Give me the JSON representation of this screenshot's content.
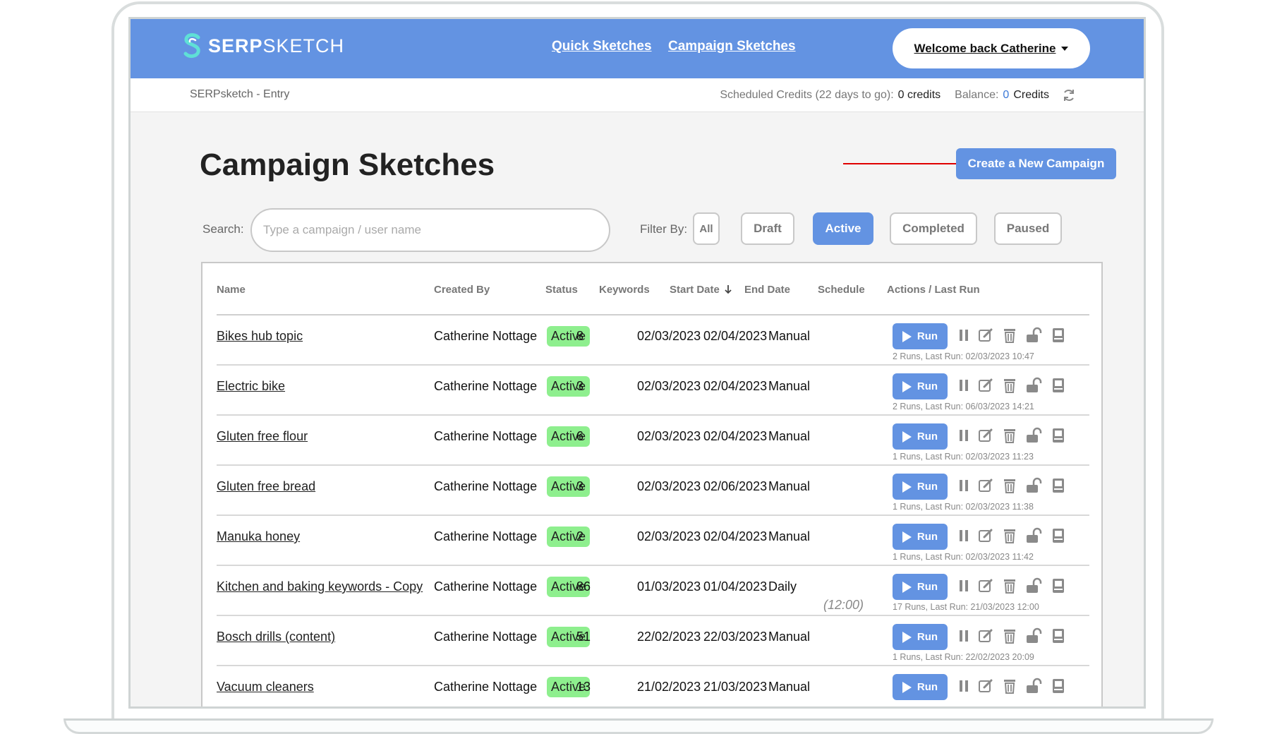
{
  "header": {
    "logo_bold": "SERP",
    "logo_light": "SKETCH",
    "nav": [
      "Quick Sketches",
      "Campaign Sketches"
    ],
    "welcome": "Welcome back Catherine"
  },
  "subbar": {
    "breadcrumb": "SERPsketch - Entry",
    "scheduled_label": "Scheduled Credits (22 days to go):",
    "scheduled_value": "0 credits",
    "balance_label": "Balance:",
    "balance_amount": "0",
    "balance_unit": "Credits"
  },
  "page": {
    "title": "Campaign Sketches",
    "create_button": "Create a New Campaign",
    "search_label": "Search:",
    "search_placeholder": "Type a campaign / user name",
    "filter_label": "Filter By:",
    "filters": [
      "All",
      "Draft",
      "Active",
      "Completed",
      "Paused"
    ],
    "active_filter": "Active"
  },
  "table": {
    "columns": [
      "Name",
      "Created By",
      "Status",
      "Keywords",
      "Start Date",
      "End Date",
      "Schedule",
      "Actions / Last Run"
    ],
    "run_label": "Run",
    "rows": [
      {
        "name": "Bikes hub topic",
        "created_by": "Catherine Nottage",
        "status": "Active",
        "keywords": "8",
        "start": "02/03/2023",
        "end": "02/04/2023",
        "schedule": "Manual",
        "schedule_sub": "",
        "last_run": "2 Runs, Last Run: 02/03/2023 10:47"
      },
      {
        "name": "Electric bike",
        "created_by": "Catherine Nottage",
        "status": "Active",
        "keywords": "3",
        "start": "02/03/2023",
        "end": "02/04/2023",
        "schedule": "Manual",
        "schedule_sub": "",
        "last_run": "2 Runs, Last Run: 06/03/2023 14:21"
      },
      {
        "name": "Gluten free flour",
        "created_by": "Catherine Nottage",
        "status": "Active",
        "keywords": "6",
        "start": "02/03/2023",
        "end": "02/04/2023",
        "schedule": "Manual",
        "schedule_sub": "",
        "last_run": "1 Runs, Last Run: 02/03/2023 11:23"
      },
      {
        "name": "Gluten free bread",
        "created_by": "Catherine Nottage",
        "status": "Active",
        "keywords": "3",
        "start": "02/03/2023",
        "end": "02/06/2023",
        "schedule": "Manual",
        "schedule_sub": "",
        "last_run": "1 Runs, Last Run: 02/03/2023 11:38"
      },
      {
        "name": "Manuka honey",
        "created_by": "Catherine Nottage",
        "status": "Active",
        "keywords": "2",
        "start": "02/03/2023",
        "end": "02/04/2023",
        "schedule": "Manual",
        "schedule_sub": "",
        "last_run": "1 Runs, Last Run: 02/03/2023 11:42"
      },
      {
        "name": "Kitchen and baking keywords - Copy",
        "created_by": "Catherine Nottage",
        "status": "Active",
        "keywords": "86",
        "start": "01/03/2023",
        "end": "01/04/2023",
        "schedule": "Daily",
        "schedule_sub": "(12:00)",
        "last_run": "17 Runs, Last Run: 21/03/2023 12:00"
      },
      {
        "name": "Bosch drills (content)",
        "created_by": "Catherine Nottage",
        "status": "Active",
        "keywords": "51",
        "start": "22/02/2023",
        "end": "22/03/2023",
        "schedule": "Manual",
        "schedule_sub": "",
        "last_run": "1 Runs, Last Run: 22/02/2023 20:09"
      },
      {
        "name": "Vacuum cleaners",
        "created_by": "Catherine Nottage",
        "status": "Active",
        "keywords": "13",
        "start": "21/02/2023",
        "end": "21/03/2023",
        "schedule": "Manual",
        "schedule_sub": "",
        "last_run": ""
      }
    ]
  },
  "colors": {
    "brand": "#6393e2",
    "active_badge": "#8eef8e",
    "annotation_arrow": "#e00000"
  },
  "icons": [
    "pause-icon",
    "edit-icon",
    "delete-icon",
    "unlock-icon",
    "report-icon",
    "refresh-icon",
    "sort-down-icon"
  ]
}
